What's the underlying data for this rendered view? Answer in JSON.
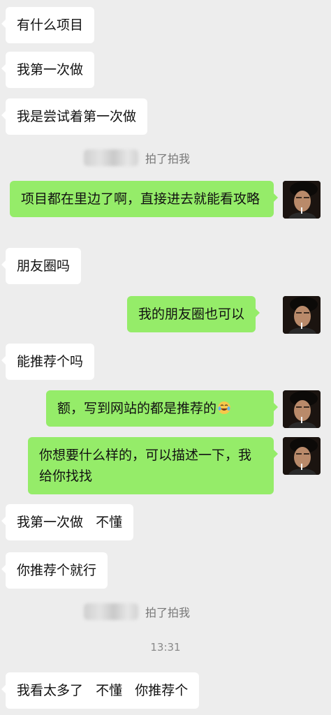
{
  "messages": [
    {
      "text": "有什么项目"
    },
    {
      "text": "我第一次做"
    },
    {
      "text": "我是尝试着第一次做"
    },
    {
      "text": "拍了拍我"
    },
    {
      "text": "项目都在里边了啊，直接进去就能看攻略"
    },
    {
      "text": "朋友圈吗"
    },
    {
      "text": "我的朋友圈也可以"
    },
    {
      "text": "能推荐个吗"
    },
    {
      "text": "额，写到网站的都是推荐的"
    },
    {
      "text": "你想要什么样的，可以描述一下，我给你找找"
    },
    {
      "text": "我第一次做   不懂"
    },
    {
      "text": "你推荐个就行"
    },
    {
      "text": "拍了拍我"
    },
    {
      "text": "13:31"
    },
    {
      "text": "我看太多了   不懂   你推荐个"
    }
  ],
  "emoji": "laugh-cry-emoji",
  "colors": {
    "background": "#ededed",
    "incoming_bubble": "#ffffff",
    "outgoing_bubble": "#95ec69",
    "system_text": "#777777"
  }
}
